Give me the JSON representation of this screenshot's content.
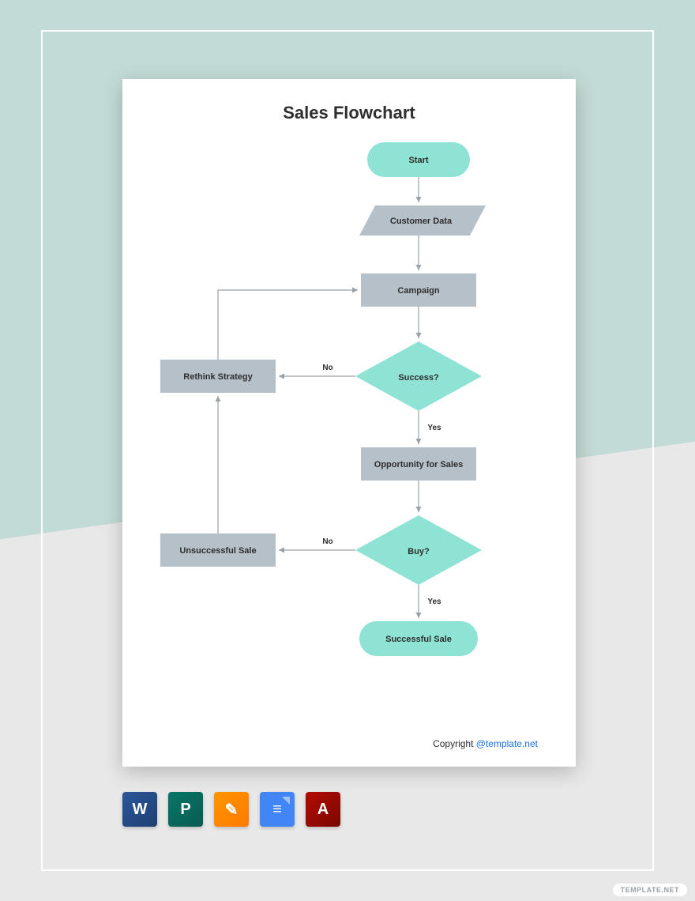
{
  "title": "Sales Flowchart",
  "colors": {
    "terminator": "#8fe3d4",
    "process": "#b6c0c9",
    "decision": "#8fe3d4",
    "stroke": "#9aa1a8"
  },
  "nodes": {
    "start": "Start",
    "customer_data": "Customer Data",
    "campaign": "Campaign",
    "success": "Success?",
    "rethink": "Rethink Strategy",
    "opportunity": "Opportunity for Sales",
    "buy": "Buy?",
    "unsuccessful": "Unsuccessful Sale",
    "successful": "Successful Sale"
  },
  "edges": {
    "no": "No",
    "yes": "Yes"
  },
  "footer": {
    "copyright": "Copyright ",
    "link": "@template.net"
  },
  "icons": {
    "word": "W",
    "publisher": "P",
    "pages": "✎",
    "gdocs": "≡",
    "pdf": "A"
  },
  "watermark": "TEMPLATE.NET"
}
